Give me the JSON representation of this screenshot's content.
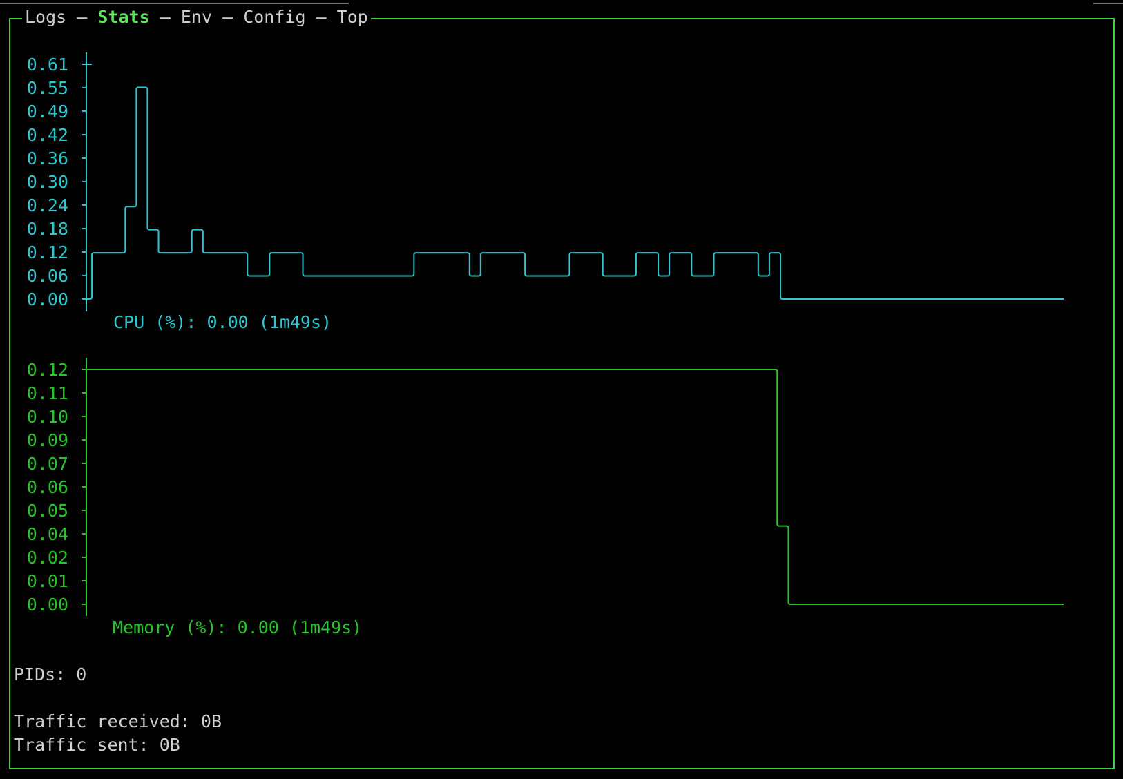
{
  "tabs": {
    "items": [
      "Logs",
      "Stats",
      "Env",
      "Config",
      "Top"
    ],
    "separator": "–",
    "active": "Stats"
  },
  "colors": {
    "frame": "#3fd13f",
    "active_tab": "#5fe35f",
    "cpu": "#2ec6cf",
    "memory": "#27c427",
    "text": "#cfcfcf",
    "background": "#000000"
  },
  "chart_data": [
    {
      "type": "line",
      "name": "cpu",
      "label": "CPU (%): 0.00 (1m49s)",
      "y_ticks": [
        "0.61",
        "0.55",
        "0.49",
        "0.42",
        "0.36",
        "0.30",
        "0.24",
        "0.18",
        "0.12",
        "0.06",
        "0.00"
      ],
      "ylim": [
        0,
        0.61
      ],
      "step": true,
      "values": [
        0.0,
        0.12,
        0.12,
        0.12,
        0.24,
        0.55,
        0.18,
        0.12,
        0.12,
        0.12,
        0.18,
        0.12,
        0.12,
        0.12,
        0.12,
        0.06,
        0.06,
        0.12,
        0.12,
        0.12,
        0.06,
        0.06,
        0.06,
        0.06,
        0.06,
        0.06,
        0.06,
        0.06,
        0.06,
        0.06,
        0.12,
        0.12,
        0.12,
        0.12,
        0.12,
        0.06,
        0.12,
        0.12,
        0.12,
        0.12,
        0.06,
        0.06,
        0.06,
        0.06,
        0.12,
        0.12,
        0.12,
        0.06,
        0.06,
        0.06,
        0.12,
        0.12,
        0.06,
        0.12,
        0.12,
        0.06,
        0.06,
        0.12,
        0.12,
        0.12,
        0.12,
        0.06,
        0.12,
        0.0,
        0.0,
        0.0,
        0.0,
        0.0,
        0.0,
        0.0,
        0.0,
        0.0,
        0.0,
        0.0,
        0.0,
        0.0,
        0.0,
        0.0,
        0.0,
        0.0,
        0.0,
        0.0,
        0.0,
        0.0,
        0.0,
        0.0,
        0.0,
        0.0,
        0.0
      ]
    },
    {
      "type": "line",
      "name": "memory",
      "label": "Memory (%): 0.00 (1m49s)",
      "y_ticks": [
        "0.12",
        "0.11",
        "0.10",
        "0.09",
        "0.07",
        "0.06",
        "0.05",
        "0.04",
        "0.02",
        "0.01",
        "0.00"
      ],
      "ylim": [
        0,
        0.12
      ],
      "step": true,
      "values": [
        0.12,
        0.12,
        0.12,
        0.12,
        0.12,
        0.12,
        0.12,
        0.12,
        0.12,
        0.12,
        0.12,
        0.12,
        0.12,
        0.12,
        0.12,
        0.12,
        0.12,
        0.12,
        0.12,
        0.12,
        0.12,
        0.12,
        0.12,
        0.12,
        0.12,
        0.12,
        0.12,
        0.12,
        0.12,
        0.12,
        0.12,
        0.12,
        0.12,
        0.12,
        0.12,
        0.12,
        0.12,
        0.12,
        0.12,
        0.12,
        0.12,
        0.12,
        0.12,
        0.12,
        0.12,
        0.12,
        0.12,
        0.12,
        0.12,
        0.12,
        0.12,
        0.12,
        0.12,
        0.12,
        0.12,
        0.12,
        0.12,
        0.12,
        0.12,
        0.12,
        0.12,
        0.12,
        0.04,
        0.0,
        0.0,
        0.0,
        0.0,
        0.0,
        0.0,
        0.0,
        0.0,
        0.0,
        0.0,
        0.0,
        0.0,
        0.0,
        0.0,
        0.0,
        0.0,
        0.0,
        0.0,
        0.0,
        0.0,
        0.0,
        0.0,
        0.0,
        0.0,
        0.0
      ]
    }
  ],
  "stats": {
    "pids": "PIDs: 0",
    "traffic_received": "Traffic received: 0B",
    "traffic_sent": "Traffic sent: 0B"
  }
}
